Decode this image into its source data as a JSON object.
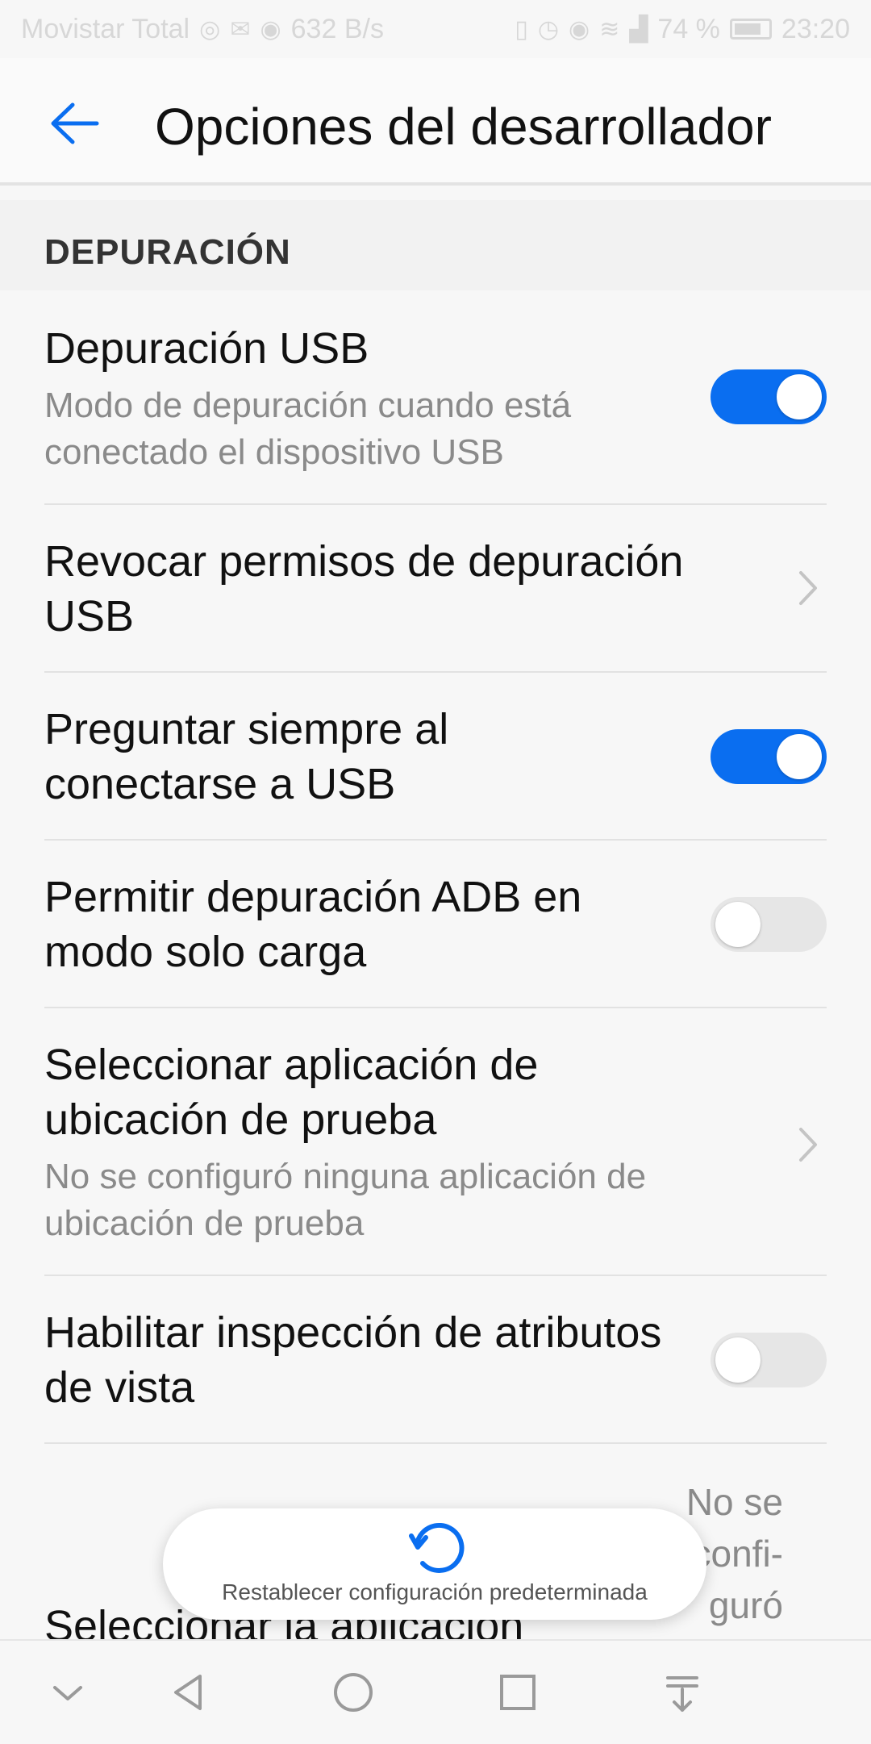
{
  "status_bar": {
    "carrier": "Movistar Total",
    "net_speed": "632 B/s",
    "battery": "74 %",
    "time": "23:20"
  },
  "app_bar": {
    "title": "Opciones del desarrollador"
  },
  "section": {
    "header": "DEPURACIÓN"
  },
  "settings": [
    {
      "title": "Depuración USB",
      "subtitle": "Modo de depuración cuando está conectado el dispositivo USB",
      "control": "toggle",
      "enabled": true
    },
    {
      "title": "Revocar permisos de depuración USB",
      "control": "chevron"
    },
    {
      "title": "Preguntar siempre al conectarse a USB",
      "control": "toggle",
      "enabled": true
    },
    {
      "title": "Permitir depuración ADB en modo solo carga",
      "control": "toggle",
      "enabled": false
    },
    {
      "title": "Seleccionar aplicación de ubicación de prueba",
      "subtitle": "No se configuró ninguna aplicación de ubicación de prueba",
      "control": "chevron"
    },
    {
      "title": "Habilitar inspección de atributos de vista",
      "control": "toggle",
      "enabled": false
    },
    {
      "title": "Seleccionar la aplicación",
      "value": "No se confi- guró nin-",
      "control": "chevron"
    }
  ],
  "toast": {
    "label": "Restablecer configuración predeterminada"
  },
  "colors": {
    "accent": "#0a6ef0",
    "toggle_off": "#e6e6e6"
  }
}
